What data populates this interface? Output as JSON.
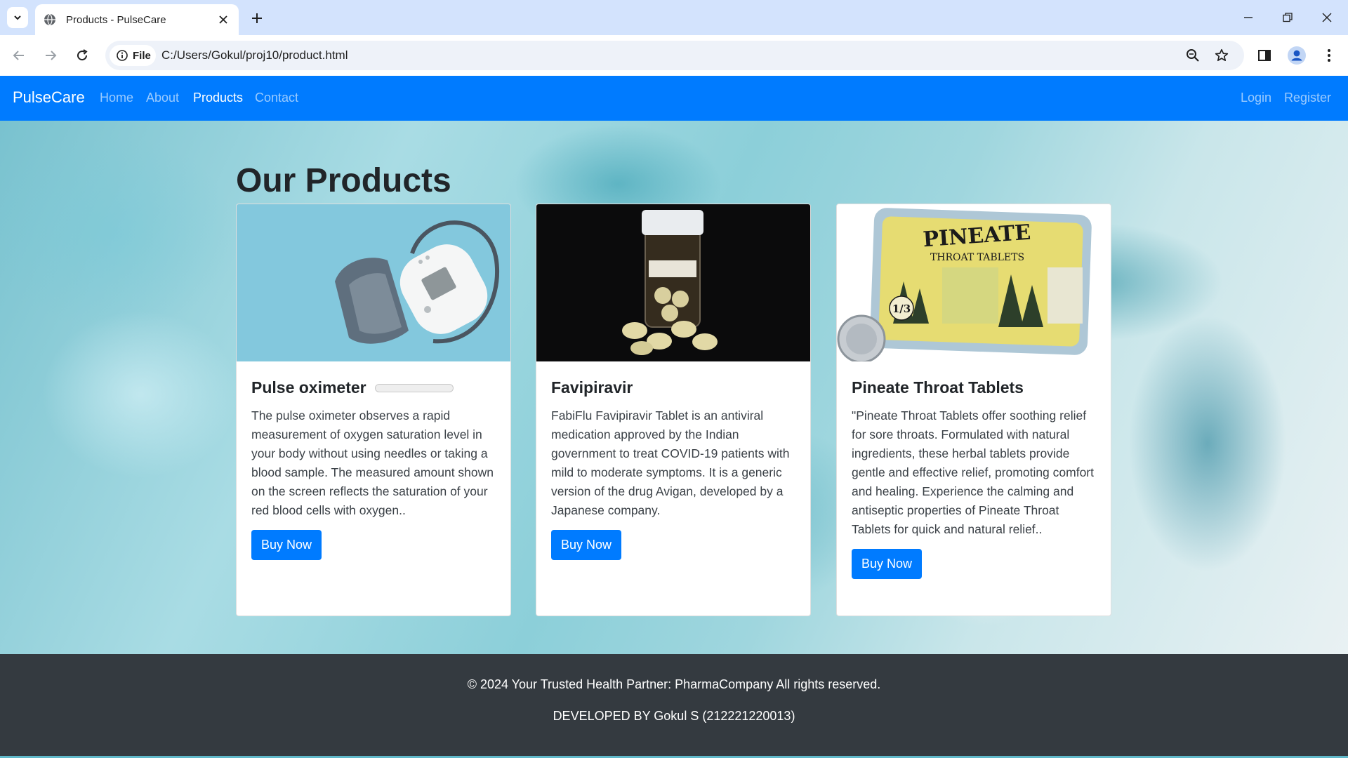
{
  "browser": {
    "tab_title": "Products - PulseCare",
    "url_chip": "File",
    "url": "C:/Users/Gokul/proj10/product.html"
  },
  "navbar": {
    "brand": "PulseCare",
    "links": [
      {
        "label": "Home"
      },
      {
        "label": "About"
      },
      {
        "label": "Products"
      },
      {
        "label": "Contact"
      }
    ],
    "active_link": "Products",
    "auth": [
      {
        "label": "Login"
      },
      {
        "label": "Register"
      }
    ],
    "background": "#007bff"
  },
  "main": {
    "title": "Our Products",
    "products": [
      {
        "title": "Pulse oximeter",
        "description": "The pulse oximeter observes a rapid measurement of oxygen saturation level in your body without using needles or taking a blood sample. The measured amount shown on the screen reflects the saturation of your red blood cells with oxygen..",
        "button": "Buy Now"
      },
      {
        "title": "Favipiravir",
        "description": "FabiFlu Favipiravir Tablet is an antiviral medication approved by the Indian government to treat COVID-19 patients with mild to moderate symptoms. It is a generic version of the drug Avigan, developed by a Japanese company.",
        "button": "Buy Now"
      },
      {
        "title": "Pineate Throat Tablets",
        "description": "\"Pineate Throat Tablets offer soothing relief for sore throats. Formulated with natural ingredients, these herbal tablets provide gentle and effective relief, promoting comfort and healing. Experience the calming and antiseptic properties of Pineate Throat Tablets for quick and natural relief..",
        "button": "Buy Now",
        "image_text": {
          "brand": "PINEATE",
          "line": "THROAT TABLETS",
          "price": "1/3"
        }
      }
    ],
    "button_color": "#007bff"
  },
  "footer": {
    "copyright": "© 2024 Your Trusted Health Partner: PharmaCompany All rights reserved.",
    "developer": "DEVELOPED BY Gokul S (212221220013)",
    "background": "#343a40"
  }
}
